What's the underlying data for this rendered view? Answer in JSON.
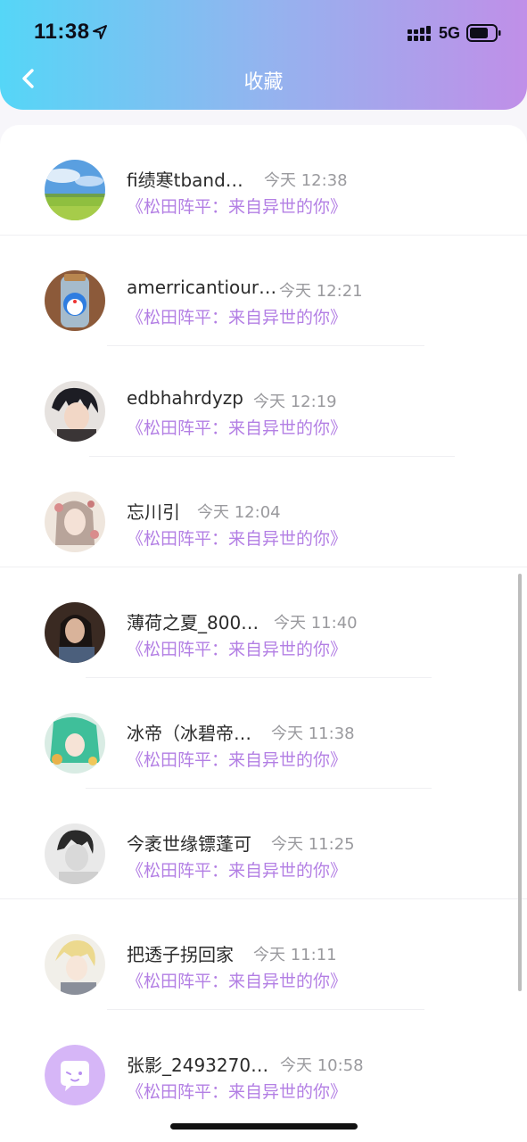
{
  "status_bar": {
    "time": "11:38",
    "network": "5G"
  },
  "header": {
    "title": "收藏"
  },
  "favorites": [
    {
      "name": "fi绩寒tband…",
      "time": "今天 12:38",
      "book": "《松田阵平：来自异世的你》",
      "avatar": "landscape"
    },
    {
      "name": "amerricantiour…",
      "time": "今天 12:21",
      "book": "《松田阵平：来自异世的你》",
      "avatar": "doraemon-jar"
    },
    {
      "name": "edbhahrdyzp",
      "time": "今天 12:19",
      "book": "《松田阵平：来自异世的你》",
      "avatar": "anime-boy-dark"
    },
    {
      "name": "忘川引",
      "time": "今天 12:04",
      "book": "《松田阵平：来自异世的你》",
      "avatar": "anime-girl-floral"
    },
    {
      "name": "薄荷之夏_800…",
      "time": "今天 11:40",
      "book": "《松田阵平：来自异世的你》",
      "avatar": "woman-photo"
    },
    {
      "name": "冰帝（冰碧帝…",
      "time": "今天 11:38",
      "book": "《松田阵平：来自异世的你》",
      "avatar": "anime-green-hair"
    },
    {
      "name": "今袤世缘镖蓬可",
      "time": "今天 11:25",
      "book": "《松田阵平：来自异世的你》",
      "avatar": "man-bw-photo"
    },
    {
      "name": "把透子拐回家",
      "time": "今天 11:11",
      "book": "《松田阵平：来自异世的你》",
      "avatar": "anime-blonde"
    },
    {
      "name": "张影_2493270…",
      "time": "今天 10:58",
      "book": "《松田阵平：来自异世的你》",
      "avatar": "default-chat"
    }
  ],
  "colors": {
    "header_gradient_start": "#55d6f7",
    "header_gradient_end": "#c08fe8",
    "book_title": "#b37fe4",
    "time_stamp": "#9a9a9e"
  }
}
